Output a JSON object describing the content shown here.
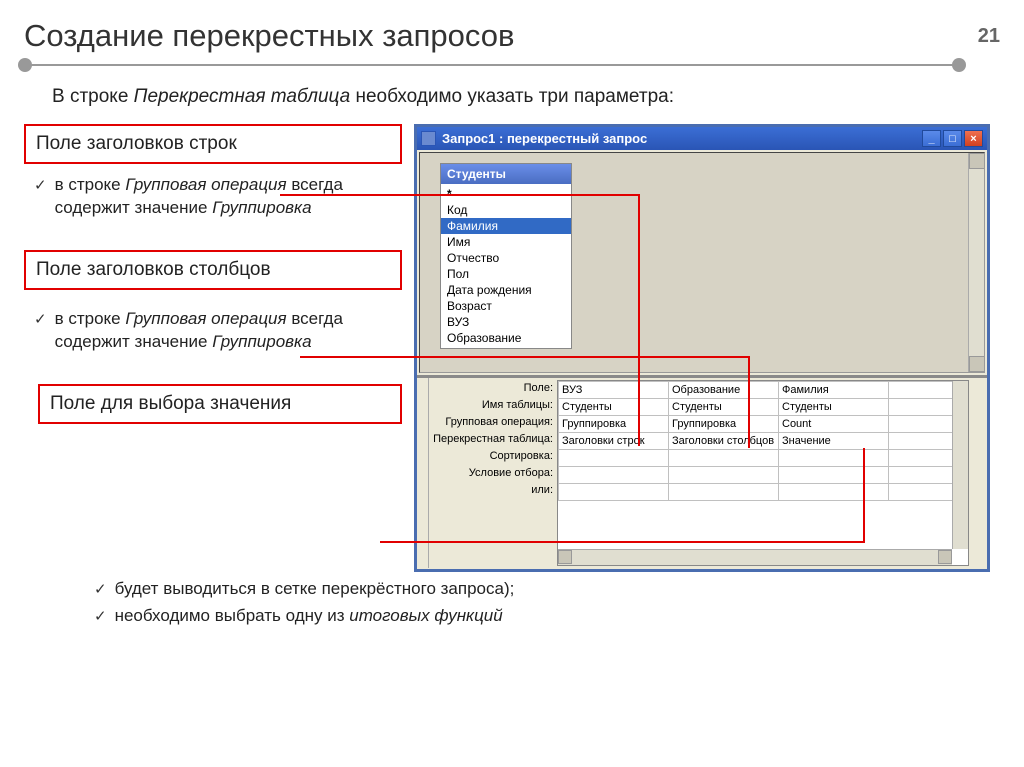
{
  "title": "Создание перекрестных запросов",
  "page_number": "21",
  "intro_pre": "В строке ",
  "intro_em": "Перекрестная таблица",
  "intro_post": " необходимо указать три параметра:",
  "callouts": {
    "rows": "Поле заголовков строк",
    "cols": "Поле заголовков столбцов",
    "value": "Поле для выбора значения"
  },
  "bullet_text_pre": "в строке ",
  "bullet_text_em": "Групповая операция",
  "bullet_text_mid": " всегда содержит значение ",
  "bullet_text_em2": "Группировка",
  "bottom_bullets": [
    "будет выводиться в сетке перекрёстного запроса);",
    "необходимо выбрать одну из "
  ],
  "bottom_em": "итоговых функций",
  "window": {
    "title": "Запрос1 : перекрестный запрос",
    "table_name": "Студенты",
    "fields": [
      "*",
      "Код",
      "Фамилия",
      "Имя",
      "Отчество",
      "Пол",
      "Дата рождения",
      "Возраст",
      "ВУЗ",
      "Образование"
    ],
    "selected_field_index": 2,
    "grid_labels": [
      "Поле:",
      "Имя таблицы:",
      "Групповая операция:",
      "Перекрестная таблица:",
      "Сортировка:",
      "Условие отбора:",
      "или:"
    ],
    "grid_cols": [
      {
        "field": "ВУЗ",
        "table": "Студенты",
        "op": "Группировка",
        "cross": "Заголовки строк"
      },
      {
        "field": "Образование",
        "table": "Студенты",
        "op": "Группировка",
        "cross": "Заголовки столбцов"
      },
      {
        "field": "Фамилия",
        "table": "Студенты",
        "op": "Count",
        "cross": "Значение"
      }
    ]
  }
}
